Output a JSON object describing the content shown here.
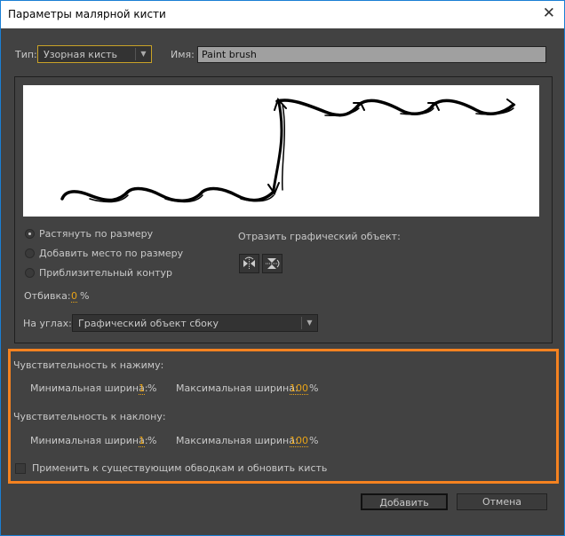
{
  "window": {
    "title": "Параметры малярной кисти",
    "close": "✕"
  },
  "type": {
    "label": "Тип:",
    "value": "Узорная кисть",
    "arrow": "▼"
  },
  "name": {
    "label": "Имя:",
    "value": "Paint brush"
  },
  "fit_options": [
    {
      "label": "Растянуть по размеру",
      "selected": true
    },
    {
      "label": "Добавить место по размеру",
      "selected": false
    },
    {
      "label": "Приблизительный контур",
      "selected": false
    }
  ],
  "flip": {
    "label": "Отразить графический объект:"
  },
  "spacing": {
    "label": "Отбивка:",
    "value": "0",
    "unit": "%"
  },
  "corners": {
    "label": "На углах:",
    "value": "Графический объект сбоку",
    "arrow": "▼"
  },
  "pressure": {
    "title": "Чувствительность к нажиму:",
    "min_label": "Минимальная ширина:",
    "min_value": "1",
    "max_label": "Максимальная ширина:",
    "max_value": "100",
    "unit": "%"
  },
  "tilt": {
    "title": "Чувствительность к наклону:",
    "min_label": "Минимальная ширина:",
    "min_value": "1",
    "max_label": "Максимальная ширина:",
    "max_value": "100",
    "unit": "%"
  },
  "apply": {
    "label": "Применить к существующим обводкам и обновить кисть",
    "checked": false
  },
  "buttons": {
    "add": "Добавить",
    "cancel": "Отмена"
  },
  "colors": {
    "accent": "#f58220",
    "value": "#e8a317",
    "background": "#424242"
  }
}
